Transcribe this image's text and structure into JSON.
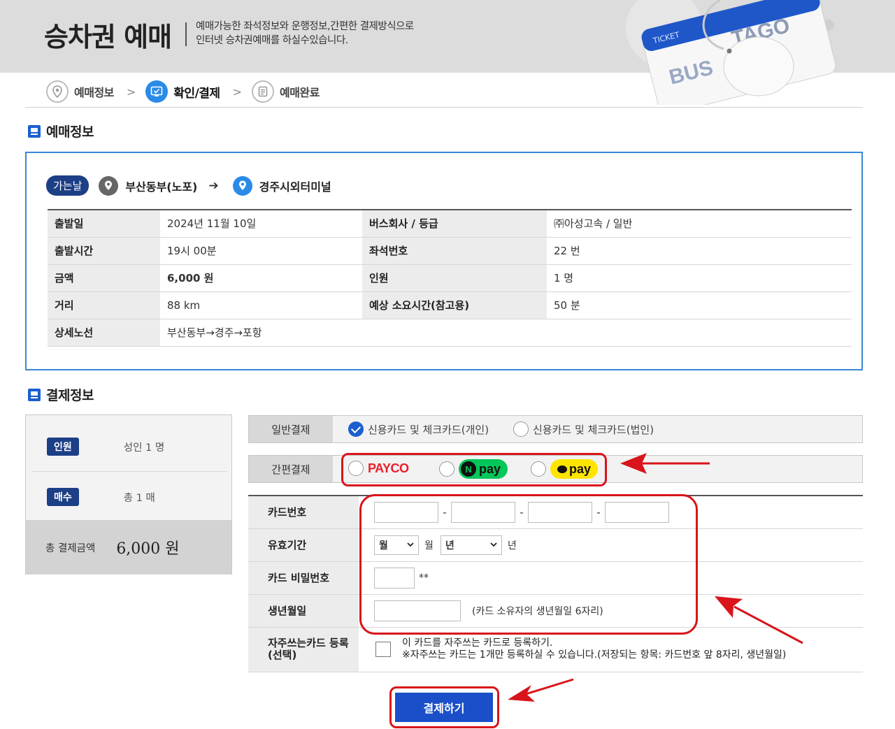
{
  "banner": {
    "title": "승차권 예매",
    "desc_line1": "예매가능한 좌석정보와 운행정보,간편한 결제방식으로",
    "desc_line2": "인터넷 승차권예매를 하실수있습니다.",
    "ticket_word": "TICKET",
    "brand_left": "BUS",
    "brand_right": "TAGO"
  },
  "steps": [
    {
      "label": "예매정보",
      "icon": "pin-icon",
      "active": false
    },
    {
      "label": "확인/결제",
      "icon": "check-screen-icon",
      "active": true
    },
    {
      "label": "예매완료",
      "icon": "receipt-icon",
      "active": false
    }
  ],
  "reservation": {
    "heading": "예매정보",
    "trip_badge": "가는날",
    "origin": "부산동부(노포)",
    "destination": "경주시외터미널",
    "rows": [
      {
        "k1": "출발일",
        "v1": "2024년 11월 10일",
        "k2": "버스회사 / 등급",
        "v2": "㈜아성고속 / 일반"
      },
      {
        "k1": "출발시간",
        "v1": "19시 00분",
        "k2": "좌석번호",
        "v2": "22 번"
      },
      {
        "k1": "금액",
        "v1": "6,000 원",
        "k2": "인원",
        "v2": "1 명"
      },
      {
        "k1": "거리",
        "v1": "88 km",
        "k2": "예상 소요시간(참고용)",
        "v2": "50 분"
      }
    ],
    "route_label": "상세노선",
    "route_value": "부산동부→경주→포항"
  },
  "payment": {
    "heading": "결제정보",
    "summary": {
      "people_badge": "인원",
      "people_value": "성인 1 명",
      "count_badge": "매수",
      "count_value": "총 1 매",
      "total_label": "총 결제금액",
      "total_value": "6,000 원"
    },
    "general": {
      "label": "일반결제",
      "option1": "신용카드 및 체크카드(개인)",
      "option2": "신용카드 및 체크카드(법인)"
    },
    "easy": {
      "label": "간편결제",
      "payco": "PAYCO",
      "npay_n": "N",
      "npay": "pay",
      "kpay": "pay"
    },
    "form": {
      "card_number_label": "카드번호",
      "expiry_label": "유효기간",
      "month_select": "월",
      "month_unit": "월",
      "year_select": "년",
      "year_unit": "년",
      "pin_label": "카드 비밀번호",
      "pin_suffix": "**",
      "birth_label": "생년월일",
      "birth_hint": "(카드 소유자의 생년월일 6자리)",
      "fav_label": "자주쓰는카드 등록(선택)",
      "fav_text1": "이 카드를 자주쓰는 카드로 등록하기.",
      "fav_text2": "※자주쓰는 카드는 1개만 등록하실 수 있습니다.(저장되는 항목: 카드번호 앞 8자리, 생년월일)"
    },
    "submit": "결제하기"
  },
  "colors": {
    "accent": "#1a5fd0",
    "highlight": "#d9141b",
    "badge": "#1d3f86"
  }
}
